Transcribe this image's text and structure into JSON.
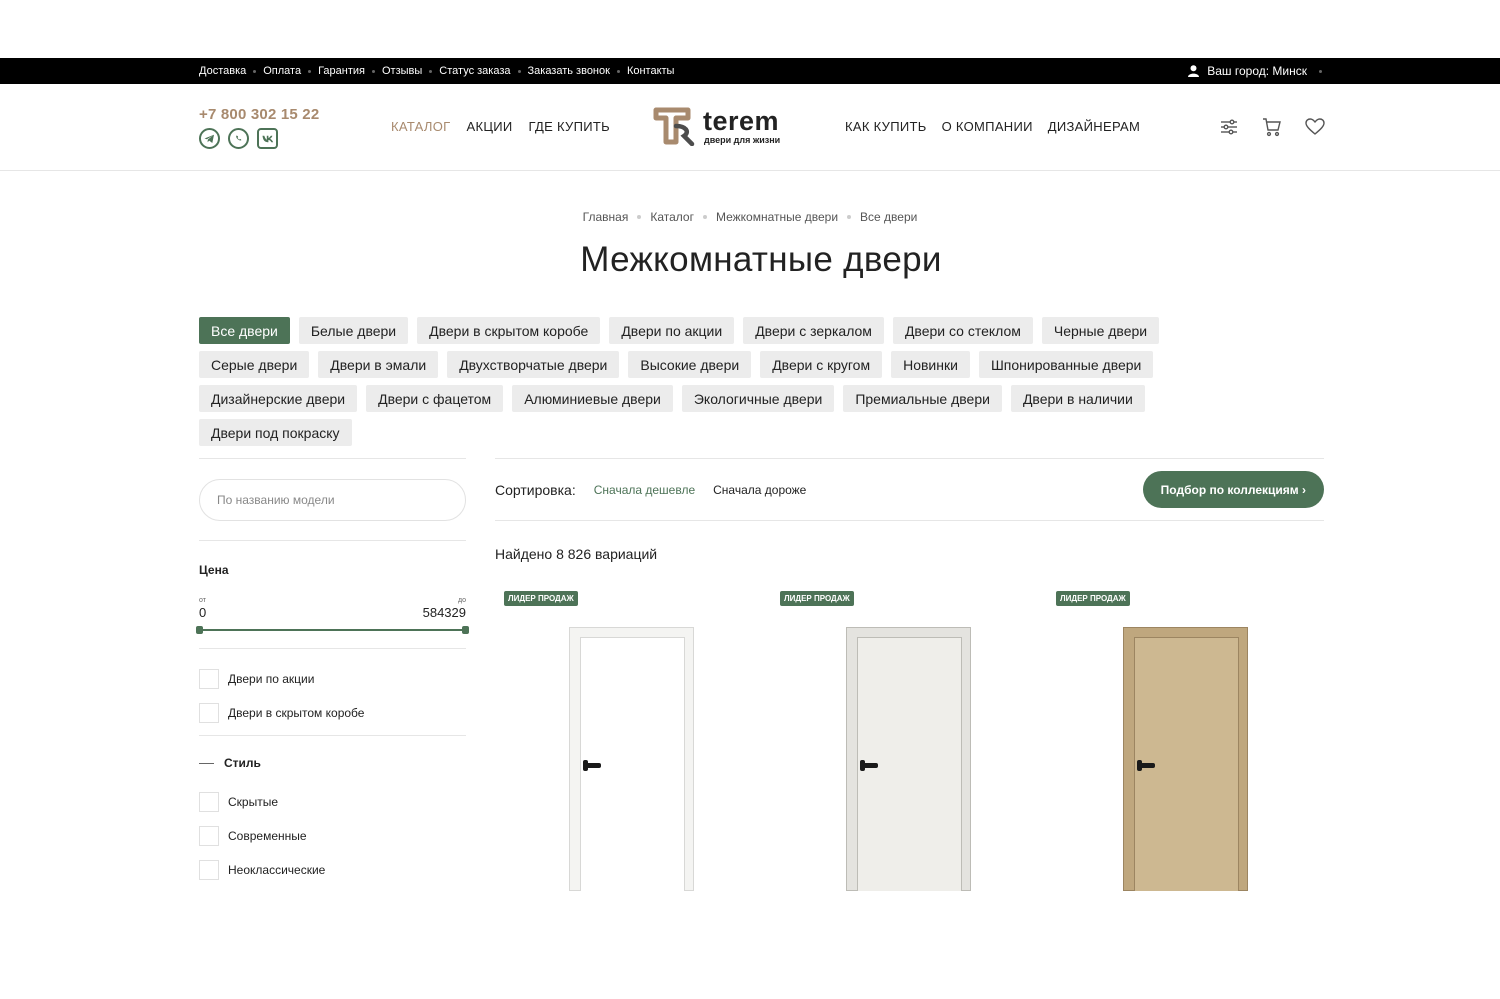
{
  "topbar": {
    "links": [
      "Доставка",
      "Оплата",
      "Гарантия",
      "Отзывы",
      "Статус заказа",
      "Заказать звонок",
      "Контакты"
    ],
    "city_label": "Ваш город: Минск"
  },
  "header": {
    "phone": "+7 800 302 15 22",
    "socials": [
      "telegram-icon",
      "whatsapp-icon",
      "vk-icon"
    ],
    "nav_left": [
      {
        "label": "КАТАЛОГ",
        "active": true
      },
      {
        "label": "АКЦИИ",
        "active": false
      },
      {
        "label": "ГДЕ КУПИТЬ",
        "active": false
      }
    ],
    "nav_right": [
      "КАК КУПИТЬ",
      "О КОМПАНИИ",
      "ДИЗАЙНЕРАМ"
    ],
    "logo": {
      "word": "terem",
      "tagline": "двери для жизни"
    },
    "icons": [
      "filter-icon",
      "cart-icon",
      "heart-icon"
    ]
  },
  "breadcrumb": [
    "Главная",
    "Каталог",
    "Межкомнатные двери",
    "Все двери"
  ],
  "page_title": "Межкомнатные двери",
  "chips": [
    {
      "label": "Все двери",
      "active": true
    },
    {
      "label": "Белые двери",
      "active": false
    },
    {
      "label": "Двери в скрытом коробе",
      "active": false
    },
    {
      "label": "Двери по акции",
      "active": false
    },
    {
      "label": "Двери с зеркалом",
      "active": false
    },
    {
      "label": "Двери со стеклом",
      "active": false
    },
    {
      "label": "Черные двери",
      "active": false
    },
    {
      "label": "Серые двери",
      "active": false
    },
    {
      "label": "Двери в эмали",
      "active": false
    },
    {
      "label": "Двухстворчатые двери",
      "active": false
    },
    {
      "label": "Высокие двери",
      "active": false
    },
    {
      "label": "Двери с кругом",
      "active": false
    },
    {
      "label": "Новинки",
      "active": false
    },
    {
      "label": "Шпонированные двери",
      "active": false
    },
    {
      "label": "Дизайнерские двери",
      "active": false
    },
    {
      "label": "Двери с фацетом",
      "active": false
    },
    {
      "label": "Алюминиевые двери",
      "active": false
    },
    {
      "label": "Экологичные двери",
      "active": false
    },
    {
      "label": "Премиальные двери",
      "active": false
    },
    {
      "label": "Двери в наличии",
      "active": false
    },
    {
      "label": "Двери под покраску",
      "active": false
    }
  ],
  "sidebar": {
    "search_placeholder": "По названию модели",
    "price": {
      "title": "Цена",
      "from_label": "от",
      "to_label": "до",
      "min": "0",
      "max": "584329"
    },
    "checks": [
      "Двери по акции",
      "Двери в скрытом коробе"
    ],
    "style_group": {
      "title": "Стиль",
      "options": [
        "Скрытые",
        "Современные",
        "Неоклассические"
      ]
    }
  },
  "sort": {
    "label": "Сортировка:",
    "options": [
      {
        "label": "Сначала дешевле",
        "selected": true
      },
      {
        "label": "Сначала дороже",
        "selected": false
      }
    ],
    "pick_button": "Подбор по коллекциям ›"
  },
  "found_text": "Найдено 8 826 вариаций",
  "products": [
    {
      "badge": "ЛИДЕР ПРОДАЖ",
      "frame": "#f4f4f2",
      "leaf": "#ffffff",
      "edge": "#d8d8d6"
    },
    {
      "badge": "ЛИДЕР ПРОДАЖ",
      "frame": "#e4e3df",
      "leaf": "#efeeea",
      "edge": "#bdbcb6"
    },
    {
      "badge": "ЛИДЕР ПРОДАЖ",
      "frame": "#bfa77e",
      "leaf": "#cdb891",
      "edge": "#9c8561"
    }
  ],
  "colors": {
    "accent_green": "#4d7357",
    "brand_brown": "#a88a6e",
    "topbar_bg": "#000000"
  }
}
